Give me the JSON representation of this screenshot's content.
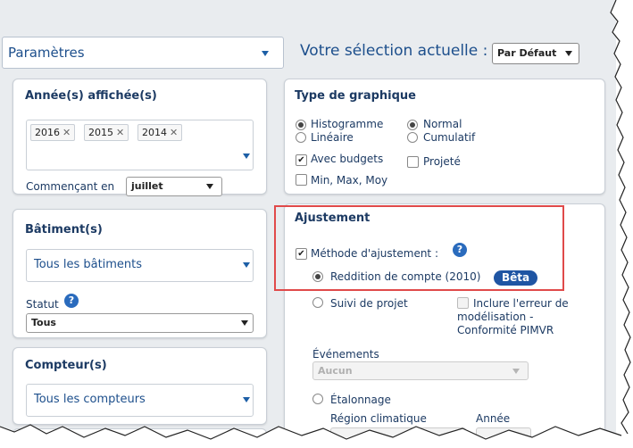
{
  "params": {
    "label": "Paramètres"
  },
  "selection": {
    "label": "Votre sélection actuelle :",
    "value": "Par Défaut"
  },
  "years": {
    "title": "Année(s) affichée(s)",
    "tags": [
      "2016",
      "2015",
      "2014"
    ],
    "start_label": "Commençant en",
    "start_value": "juillet"
  },
  "buildings": {
    "title": "Bâtiment(s)",
    "value": "Tous les bâtiments",
    "status_label": "Statut",
    "status_value": "Tous"
  },
  "meters": {
    "title": "Compteur(s)",
    "value": "Tous les compteurs"
  },
  "graph_type": {
    "title": "Type de graphique",
    "histogram": "Histogramme",
    "linear": "Linéaire",
    "normal": "Normal",
    "cumulative": "Cumulatif",
    "budgets": "Avec budgets",
    "projected": "Projeté",
    "minmax": "Min, Max, Moy"
  },
  "adjustment": {
    "title": "Ajustement",
    "method": "Méthode d'ajustement :",
    "accountability": "Reddition de compte (2010)",
    "beta": "Bêta",
    "project_followup": "Suivi de projet",
    "include_error": "Inclure l'erreur de",
    "modeling": "modélisation -",
    "conformity": "Conformité PIMVR",
    "events_label": "Événements",
    "events_value": "Aucun",
    "calibration": "Étalonnage",
    "climate_region": "Région climatique",
    "year": "Année"
  },
  "colors": {
    "highlight": "#e04a4a",
    "accent": "#1f55a3"
  }
}
